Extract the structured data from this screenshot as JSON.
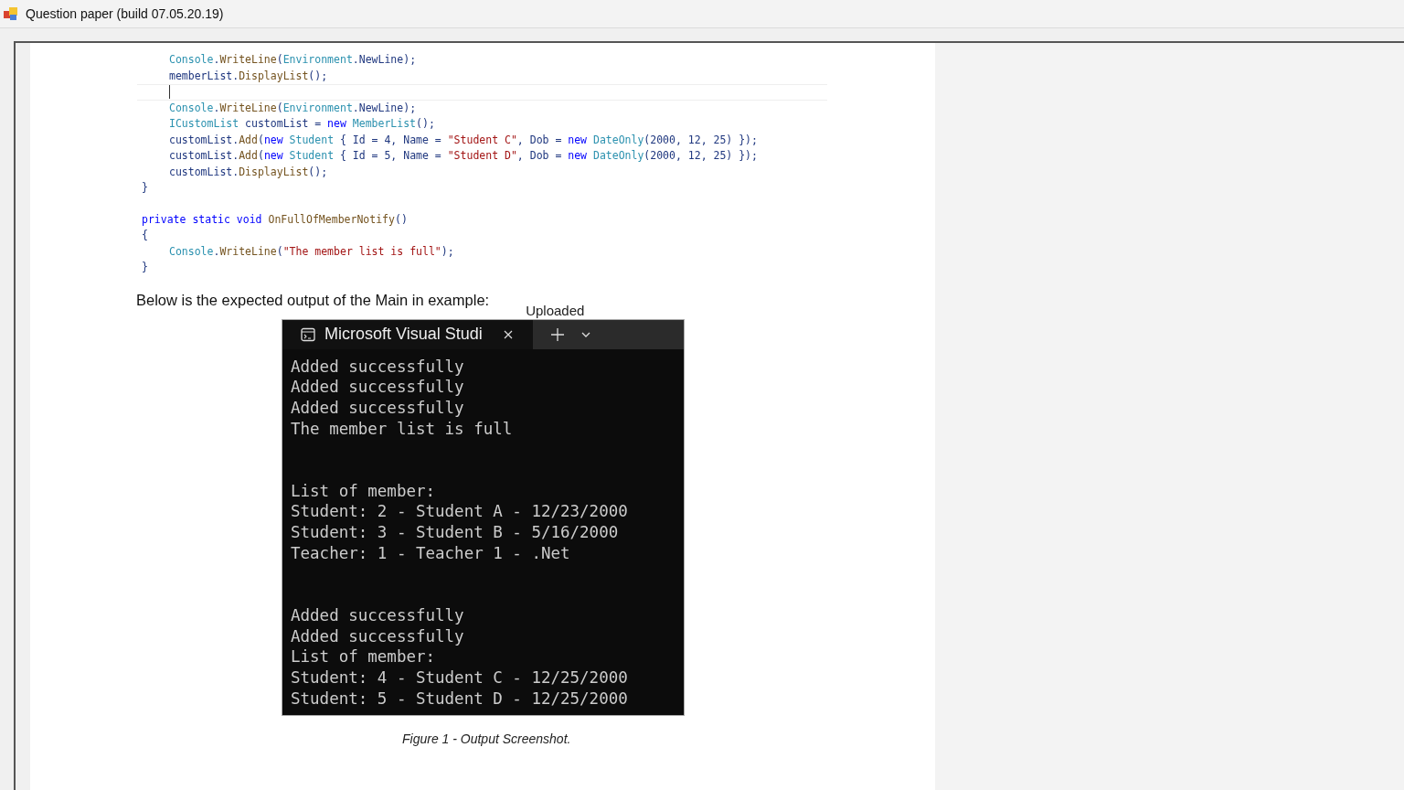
{
  "window": {
    "title": "Question paper (build 07.05.20.19)"
  },
  "code_blocks": [
    {
      "lines": [
        {
          "kind": "inner",
          "tokens": [
            {
              "text": "Console",
              "kind": "type"
            },
            {
              "text": ".",
              "kind": "plain"
            },
            {
              "text": "WriteLine",
              "kind": "method"
            },
            {
              "text": "(",
              "kind": "plain"
            },
            {
              "text": "Environment",
              "kind": "type"
            },
            {
              "text": ".NewLine);",
              "kind": "plain"
            }
          ]
        },
        {
          "kind": "inner",
          "tokens": [
            {
              "text": "memberList.",
              "kind": "plain"
            },
            {
              "text": "DisplayList",
              "kind": "method"
            },
            {
              "text": "();",
              "kind": "plain"
            }
          ]
        },
        {
          "kind": "caret"
        },
        {
          "kind": "inner",
          "tokens": [
            {
              "text": "Console",
              "kind": "type"
            },
            {
              "text": ".",
              "kind": "plain"
            },
            {
              "text": "WriteLine",
              "kind": "method"
            },
            {
              "text": "(",
              "kind": "plain"
            },
            {
              "text": "Environment",
              "kind": "type"
            },
            {
              "text": ".NewLine);",
              "kind": "plain"
            }
          ]
        },
        {
          "kind": "inner",
          "tokens": [
            {
              "text": "ICustomList",
              "kind": "type"
            },
            {
              "text": " customList = ",
              "kind": "plain"
            },
            {
              "text": "new ",
              "kind": "keyword"
            },
            {
              "text": "MemberList",
              "kind": "type"
            },
            {
              "text": "();",
              "kind": "plain"
            }
          ]
        },
        {
          "kind": "inner",
          "tokens": [
            {
              "text": "customList.",
              "kind": "plain"
            },
            {
              "text": "Add",
              "kind": "method"
            },
            {
              "text": "(",
              "kind": "plain"
            },
            {
              "text": "new ",
              "kind": "keyword"
            },
            {
              "text": "Student",
              "kind": "type"
            },
            {
              "text": " { Id = 4, Name = ",
              "kind": "plain"
            },
            {
              "text": "\"Student C\"",
              "kind": "string"
            },
            {
              "text": ", Dob = ",
              "kind": "plain"
            },
            {
              "text": "new ",
              "kind": "keyword"
            },
            {
              "text": "DateOnly",
              "kind": "type"
            },
            {
              "text": "(2000, 12, 25) });",
              "kind": "plain"
            }
          ]
        },
        {
          "kind": "inner",
          "tokens": [
            {
              "text": "customList.",
              "kind": "plain"
            },
            {
              "text": "Add",
              "kind": "method"
            },
            {
              "text": "(",
              "kind": "plain"
            },
            {
              "text": "new ",
              "kind": "keyword"
            },
            {
              "text": "Student",
              "kind": "type"
            },
            {
              "text": " { Id = 5, Name = ",
              "kind": "plain"
            },
            {
              "text": "\"Student D\"",
              "kind": "string"
            },
            {
              "text": ", Dob = ",
              "kind": "plain"
            },
            {
              "text": "new ",
              "kind": "keyword"
            },
            {
              "text": "DateOnly",
              "kind": "type"
            },
            {
              "text": "(2000, 12, 25) });",
              "kind": "plain"
            }
          ]
        },
        {
          "kind": "inner",
          "tokens": [
            {
              "text": "customList.",
              "kind": "plain"
            },
            {
              "text": "DisplayList",
              "kind": "method"
            },
            {
              "text": "();",
              "kind": "plain"
            }
          ]
        },
        {
          "kind": "outer",
          "tokens": [
            {
              "text": "}",
              "kind": "plain"
            }
          ]
        }
      ]
    },
    {
      "lines": [
        {
          "kind": "outer",
          "tokens": [
            {
              "text": "private static void ",
              "kind": "keyword"
            },
            {
              "text": "OnFullOfMemberNotify",
              "kind": "method"
            },
            {
              "text": "()",
              "kind": "plain"
            }
          ]
        },
        {
          "kind": "outer",
          "tokens": [
            {
              "text": "{",
              "kind": "plain"
            }
          ]
        },
        {
          "kind": "inner",
          "tokens": [
            {
              "text": "Console",
              "kind": "type"
            },
            {
              "text": ".",
              "kind": "plain"
            },
            {
              "text": "WriteLine",
              "kind": "method"
            },
            {
              "text": "(",
              "kind": "plain"
            },
            {
              "text": "\"The member list is full\"",
              "kind": "string"
            },
            {
              "text": ");",
              "kind": "plain"
            }
          ]
        },
        {
          "kind": "outer",
          "tokens": [
            {
              "text": "}",
              "kind": "plain"
            }
          ]
        }
      ]
    }
  ],
  "paragraph": "Below is the expected output of the Main in example:",
  "uploaded_label": "Uploaded",
  "terminal": {
    "tab_title": "Microsoft Visual Studi",
    "output_blocks": [
      [
        "Added successfully",
        "Added successfully",
        "Added successfully",
        "The member list is full"
      ],
      [
        "List of member:",
        "Student: 2 - Student A - 12/23/2000",
        "Student: 3 - Student B - 5/16/2000",
        "Teacher: 1 - Teacher 1 - .Net"
      ],
      [
        "Added successfully",
        "Added successfully",
        "List of member:",
        "Student: 4 - Student C - 12/25/2000",
        "Student: 5 - Student D - 12/25/2000"
      ]
    ]
  },
  "caption": "Figure 1 - Output Screenshot."
}
